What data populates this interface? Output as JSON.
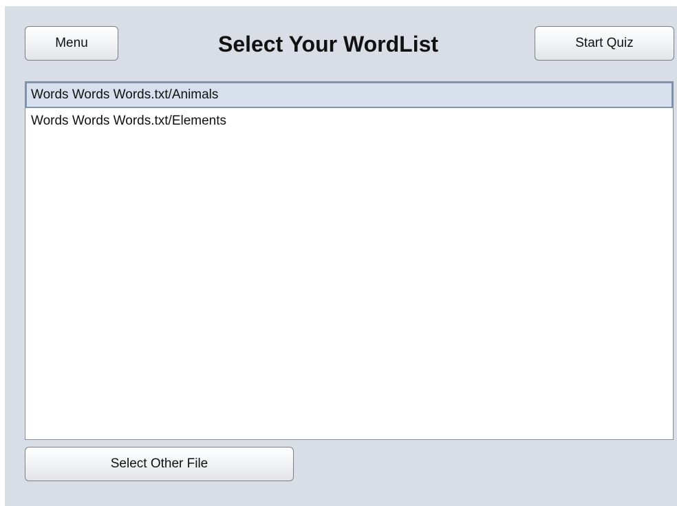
{
  "header": {
    "menu_label": "Menu",
    "title": "Select Your WordList",
    "start_quiz_label": "Start Quiz"
  },
  "wordlists": {
    "items": [
      {
        "label": "Words Words Words.txt/Animals",
        "selected": true
      },
      {
        "label": "Words Words Words.txt/Elements",
        "selected": false
      }
    ]
  },
  "footer": {
    "select_other_file_label": "Select Other File"
  },
  "colors": {
    "window_background": "#d9dde5",
    "selection_background": "#d7e0ec",
    "selection_border": "#7d93b2"
  }
}
